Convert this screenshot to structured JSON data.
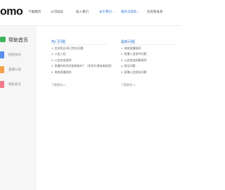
{
  "header": {
    "logo": "omo",
    "nav": [
      {
        "label": "下载模因",
        "active": false
      },
      {
        "label": "公司动态",
        "active": false
      },
      {
        "label": "加入我们",
        "active": false
      },
      {
        "label": "关于我们",
        "active": true,
        "has_chevron": true
      },
      {
        "label": "服务与帮助",
        "active": true,
        "has_chevron": true
      },
      {
        "label": "投资者关系",
        "active": false
      }
    ]
  },
  "sidebar": {
    "items": [
      {
        "label": "帮助首页",
        "icon": "help-home-icon",
        "color": "#3fb55a"
      },
      {
        "label": "招招会员",
        "icon": "member-icon",
        "color": "#5b8def"
      },
      {
        "label": "直播公会",
        "icon": "guild-icon",
        "color": "#f5a04a"
      },
      {
        "label": "隐私安全",
        "icon": "privacy-icon",
        "color": "#f07a8a"
      }
    ]
  },
  "hot": {
    "title": "热门问题",
    "items": [
      "1. 会员购买/续订常见问题",
      "2. 公会入驻",
      "3. 公会合成说明",
      "4. 直播间如何添加购物车？（如何开通电商权限）",
      "5. 电商直播规则"
    ],
    "more": "了解更多>>"
  },
  "latest": {
    "title": "最新问题",
    "items": [
      "1. 电商直播规则",
      "2. 直播入会条件问题",
      "3. 公会收益结算规则",
      "4. 常见问题",
      "5. 直播公会相关问题"
    ],
    "more": "了解更多>>"
  },
  "colors": {
    "accent": "#3a7bd5",
    "sidebar_bg": "#f6f6f6"
  }
}
